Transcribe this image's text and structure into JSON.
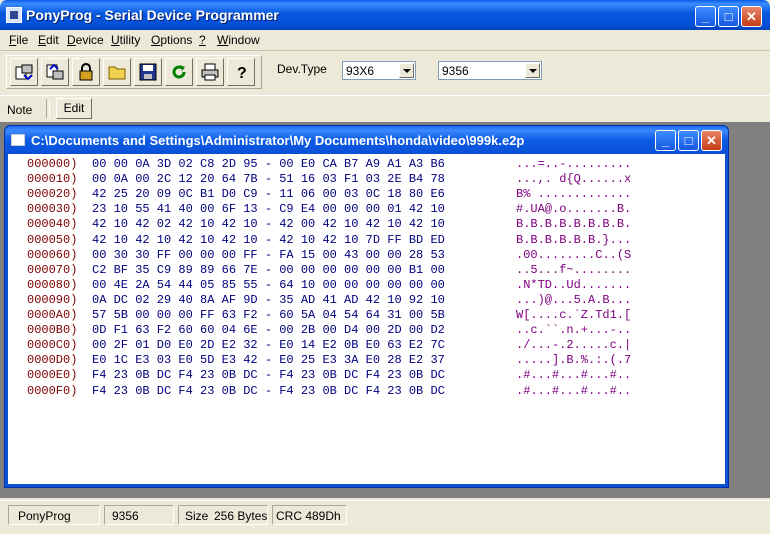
{
  "window": {
    "title": "PonyProg - Serial Device Programmer"
  },
  "menu": [
    {
      "label": "File",
      "u": "F",
      "rest": "ile"
    },
    {
      "label": "Edit",
      "u": "E",
      "rest": "dit"
    },
    {
      "label": "Device",
      "u": "D",
      "rest": "evice"
    },
    {
      "label": "Utility",
      "u": "U",
      "rest": "tility"
    },
    {
      "label": "Options",
      "u": "O",
      "rest": "ptions"
    },
    {
      "label": "?",
      "u": "?",
      "rest": ""
    },
    {
      "label": "Window",
      "u": "W",
      "rest": "indow"
    }
  ],
  "toolbar": {
    "buttons": [
      "read-device-icon",
      "write-device-icon",
      "lock-icon",
      "open-folder-icon",
      "save-disk-icon",
      "reload-icon",
      "print-icon",
      "help-icon"
    ],
    "dev_type_label": "Dev.Type",
    "family_value": "93X6",
    "device_value": "9356"
  },
  "note": {
    "label": "Note",
    "edit_button": "Edit"
  },
  "child": {
    "title": "C:\\Documents and Settings\\Administrator\\My Documents\\honda\\video\\999k.e2p",
    "rows": [
      {
        "addr": "000000)",
        "hex": "00 00 0A 3D 02 C8 2D 95 - 00 E0 CA B7 A9 A1 A3 B6",
        "ascii": "...=..-........."
      },
      {
        "addr": "000010)",
        "hex": "00 0A 00 2C 12 20 64 7B - 51 16 03 F1 03 2E B4 78",
        "ascii": "...,. d{Q......x"
      },
      {
        "addr": "000020)",
        "hex": "42 25 20 09 0C B1 D0 C9 - 11 06 00 03 0C 18 80 E6",
        "ascii": "B% ............."
      },
      {
        "addr": "000030)",
        "hex": "23 10 55 41 40 00 6F 13 - C9 E4 00 00 00 01 42 10",
        "ascii": "#.UA@.o.......B."
      },
      {
        "addr": "000040)",
        "hex": "42 10 42 02 42 10 42 10 - 42 00 42 10 42 10 42 10",
        "ascii": "B.B.B.B.B.B.B.B."
      },
      {
        "addr": "000050)",
        "hex": "42 10 42 10 42 10 42 10 - 42 10 42 10 7D FF BD ED",
        "ascii": "B.B.B.B.B.B.}..."
      },
      {
        "addr": "000060)",
        "hex": "00 30 30 FF 00 00 00 FF - FA 15 00 43 00 00 28 53",
        "ascii": ".00........C..(S"
      },
      {
        "addr": "000070)",
        "hex": "C2 BF 35 C9 89 89 66 7E - 00 00 00 00 00 00 B1 00",
        "ascii": "..5...f~........"
      },
      {
        "addr": "000080)",
        "hex": "00 4E 2A 54 44 05 85 55 - 64 10 00 00 00 00 00 00",
        "ascii": ".N*TD..Ud......."
      },
      {
        "addr": "000090)",
        "hex": "0A DC 02 29 40 8A AF 9D - 35 AD 41 AD 42 10 92 10",
        "ascii": "...)@...5.A.B..."
      },
      {
        "addr": "0000A0)",
        "hex": "57 5B 00 00 00 FF 63 F2 - 60 5A 04 54 64 31 00 5B",
        "ascii": "W[....c.`Z.Td1.["
      },
      {
        "addr": "0000B0)",
        "hex": "0D F1 63 F2 60 60 04 6E - 00 2B 00 D4 00 2D 00 D2",
        "ascii": "..c.``.n.+...-.."
      },
      {
        "addr": "0000C0)",
        "hex": "00 2F 01 D0 E0 2D E2 32 - E0 14 E2 0B E0 63 E2 7C",
        "ascii": "./...-.2.....c.|"
      },
      {
        "addr": "0000D0)",
        "hex": "E0 1C E3 03 E0 5D E3 42 - E0 25 E3 3A E0 28 E2 37",
        "ascii": ".....].B.%.:.(.7"
      },
      {
        "addr": "0000E0)",
        "hex": "F4 23 0B DC F4 23 0B DC - F4 23 0B DC F4 23 0B DC",
        "ascii": ".#...#...#...#.."
      },
      {
        "addr": "0000F0)",
        "hex": "F4 23 0B DC F4 23 0B DC - F4 23 0B DC F4 23 0B DC",
        "ascii": ".#...#...#...#.."
      }
    ]
  },
  "status": {
    "app": "PonyProg",
    "device": "9356",
    "size_label": "Size",
    "size_value": "256 Bytes",
    "crc": "CRC  489Dh"
  }
}
